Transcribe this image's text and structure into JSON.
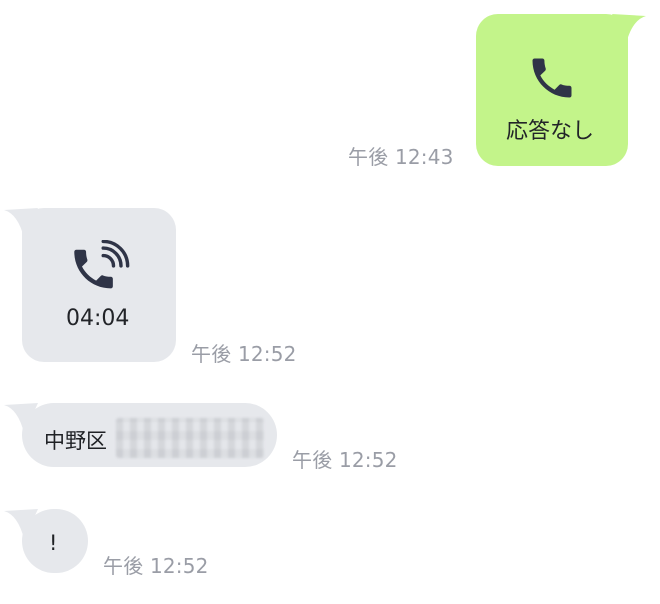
{
  "messages": [
    {
      "direction": "outgoing",
      "kind": "call",
      "icon": "phone-icon",
      "label": "応答なし",
      "time": "午後 12:43"
    },
    {
      "direction": "incoming",
      "kind": "call",
      "icon": "phone-ringing-icon",
      "label": "04:04",
      "time": "午後 12:52"
    },
    {
      "direction": "incoming",
      "kind": "text",
      "text": "中野区",
      "redacted": true,
      "time": "午後 12:52"
    },
    {
      "direction": "incoming",
      "kind": "text",
      "text": "!",
      "time": "午後 12:52"
    }
  ],
  "colors": {
    "outgoing_bubble": "#c3f48a",
    "incoming_bubble": "#e6e8ec",
    "icon": "#2f3447",
    "time": "#9a9da6"
  }
}
